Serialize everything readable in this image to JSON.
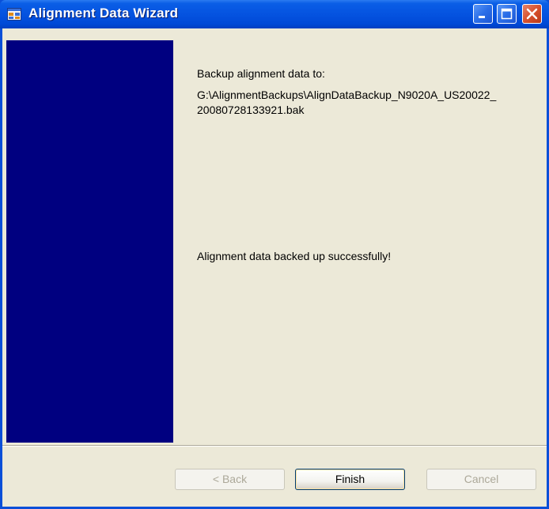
{
  "window": {
    "title": "Alignment Data Wizard",
    "icon": "app-window-icon",
    "controls": [
      "minimize-icon",
      "maximize-icon",
      "close-icon"
    ]
  },
  "content": {
    "backup_label": "Backup alignment data to:",
    "backup_path_line1": "G:\\AlignmentBackups\\AlignDataBackup_N9020A_US20022_",
    "backup_path_line2": "20080728133921.bak",
    "status_message": "Alignment data backed up successfully!"
  },
  "buttons": {
    "back_label": "< Back",
    "finish_label": "Finish",
    "cancel_label": "Cancel"
  },
  "colors": {
    "titlebar": "#0553e0",
    "side_panel": "#000080",
    "dialog_background": "#ece9d8",
    "close_button": "#d8512e"
  }
}
